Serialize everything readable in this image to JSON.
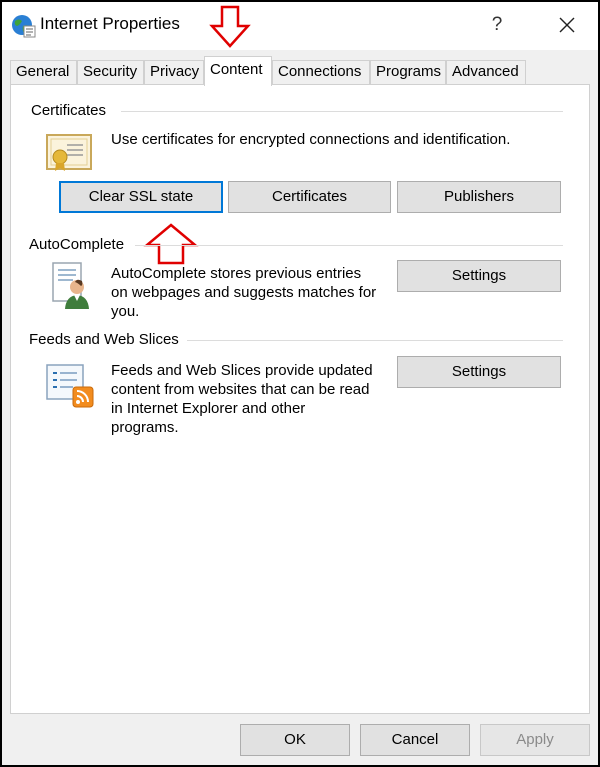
{
  "window": {
    "title": "Internet Properties",
    "help_label": "?",
    "close_label": "✕"
  },
  "tabs": [
    {
      "label": "General"
    },
    {
      "label": "Security"
    },
    {
      "label": "Privacy"
    },
    {
      "label": "Content",
      "active": true
    },
    {
      "label": "Connections"
    },
    {
      "label": "Programs"
    },
    {
      "label": "Advanced"
    }
  ],
  "certificates": {
    "title": "Certificates",
    "description": "Use certificates for encrypted connections and identification.",
    "clear_ssl_label": "Clear SSL state",
    "certificates_label": "Certificates",
    "publishers_label": "Publishers",
    "icon": "certificate-icon"
  },
  "autocomplete": {
    "title": "AutoComplete",
    "line1": "AutoComplete stores previous entries",
    "line2": "on webpages and suggests matches for",
    "line3": "you.",
    "settings_label": "Settings",
    "icon": "autocomplete-user-icon"
  },
  "feeds": {
    "title": "Feeds and Web Slices",
    "line1": "Feeds and Web Slices provide updated",
    "line2": "content from websites that can be read",
    "line3": "in Internet Explorer and other",
    "line4": "programs.",
    "settings_label": "Settings",
    "icon": "rss-feed-icon"
  },
  "footer": {
    "ok_label": "OK",
    "cancel_label": "Cancel",
    "apply_label": "Apply"
  },
  "annotations": {
    "arrow_color": "#e00000"
  }
}
